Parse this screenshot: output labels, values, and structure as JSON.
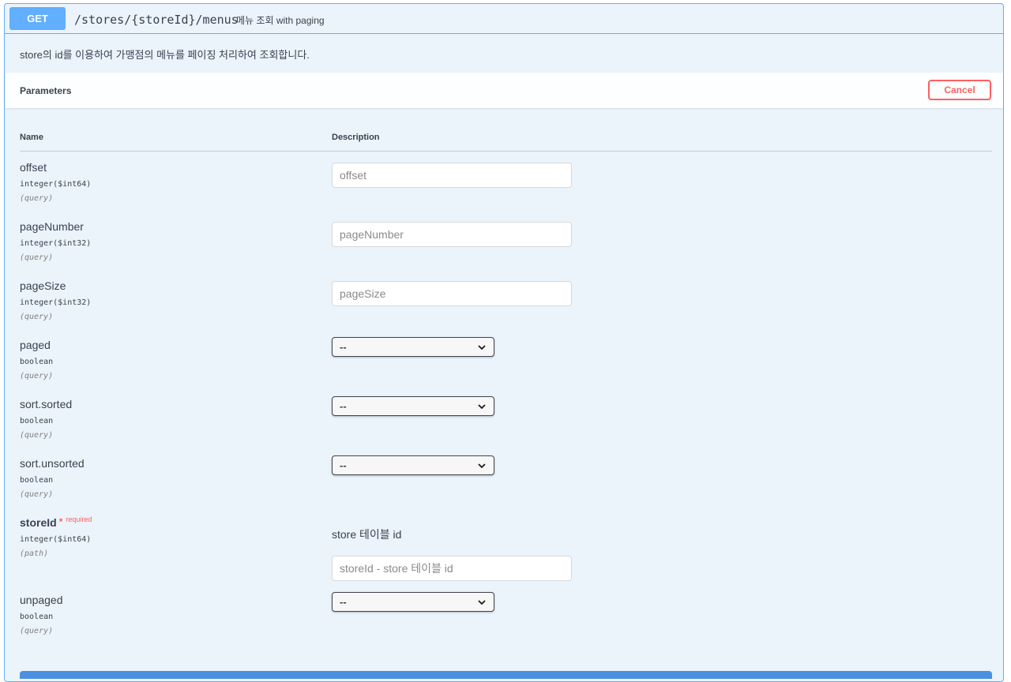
{
  "operation": {
    "method": "GET",
    "path": "/stores/{storeId}/menus",
    "summary": "메뉴 조회 with paging",
    "description": "store의 id를 이용하여 가맹점의 메뉴를 페이징 처리하여 조회합니다."
  },
  "section": {
    "title": "Parameters",
    "cancel_label": "Cancel"
  },
  "columns": {
    "name": "Name",
    "description": "Description"
  },
  "params": [
    {
      "name": "offset",
      "type": "integer($int64)",
      "in": "(query)",
      "placeholder": "offset"
    },
    {
      "name": "pageNumber",
      "type": "integer($int32)",
      "in": "(query)",
      "placeholder": "pageNumber"
    },
    {
      "name": "pageSize",
      "type": "integer($int32)",
      "in": "(query)",
      "placeholder": "pageSize"
    },
    {
      "name": "paged",
      "type": "boolean",
      "in": "(query)",
      "selected": "--"
    },
    {
      "name": "sort.sorted",
      "type": "boolean",
      "in": "(query)",
      "selected": "--"
    },
    {
      "name": "sort.unsorted",
      "type": "boolean",
      "in": "(query)",
      "selected": "--"
    },
    {
      "name": "storeId",
      "required_star": "*",
      "required_label": "required",
      "type": "integer($int64)",
      "in": "(path)",
      "description": "store 테이블 id",
      "placeholder": "storeId - store 테이블 id"
    },
    {
      "name": "unpaged",
      "type": "boolean",
      "in": "(query)",
      "selected": "--"
    }
  ],
  "colors": {
    "get_method": "#61affe",
    "cancel": "#ff6060",
    "block_bg": "#ebf3fb",
    "execute": "#4990e2"
  },
  "icons": {
    "select_arrow": "chevron-down-icon"
  }
}
